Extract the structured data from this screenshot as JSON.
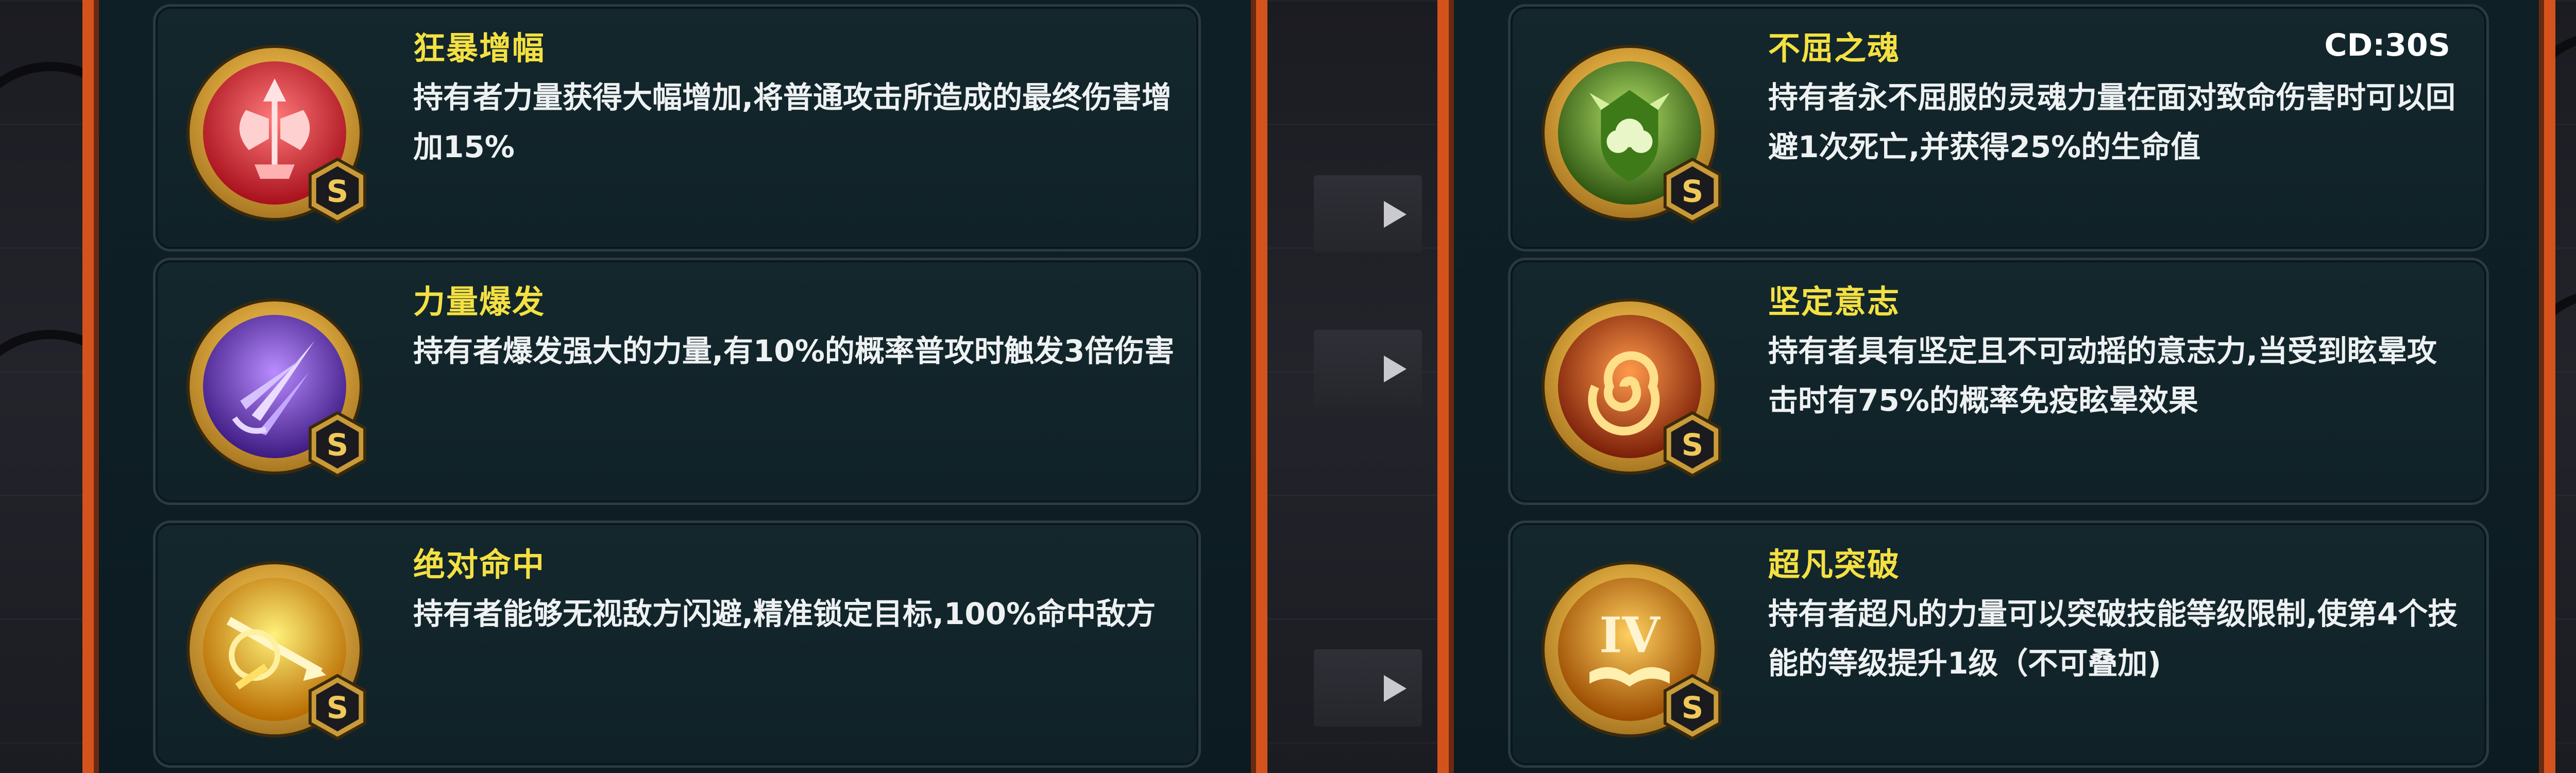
{
  "left_panel": {
    "skills": [
      {
        "title": "狂暴增幅",
        "description": "持有者力量获得大幅增加,将普通攻击所造成的最终伤害增加15%",
        "icon": "rage-axe-icon",
        "rank": "S",
        "color": "#d9323a"
      },
      {
        "title": "力量爆发",
        "description": "持有者爆发强大的力量,有10%的概率普攻时触发3倍伤害",
        "icon": "power-burst-icon",
        "rank": "S",
        "color": "#7a3fc8"
      },
      {
        "title": "绝对命中",
        "description": "持有者能够无视敌方闪避,精准锁定目标,100%命中敌方",
        "icon": "absolute-hit-icon",
        "rank": "S",
        "color": "#f0b010"
      }
    ]
  },
  "right_panel": {
    "skills": [
      {
        "title": "不屈之魂",
        "description": "持有者永不屈服的灵魂力量在面对致命伤害时可以回避1次死亡,并获得25%的生命值",
        "icon": "undying-soul-icon",
        "rank": "S",
        "cooldown": "CD:30S",
        "color": "#6aa82a"
      },
      {
        "title": "坚定意志",
        "description": "持有者具有坚定且不可动摇的意志力,当受到眩晕攻击时有75%的概率免疫眩晕效果",
        "icon": "firm-will-icon",
        "rank": "S",
        "color": "#d0521c"
      },
      {
        "title": "超凡突破",
        "description": "持有者超凡的力量可以突破技能等级限制,使第4个技能的等级提升1级（不可叠加)",
        "icon": "transcend-book-icon",
        "rank": "S",
        "emblem": "IV",
        "color": "#e08a10"
      }
    ]
  },
  "colors": {
    "title_yellow": "#f4e042",
    "panel_border": "#d4531d",
    "card_bg": "#13272d",
    "text": "#eef1f2"
  }
}
